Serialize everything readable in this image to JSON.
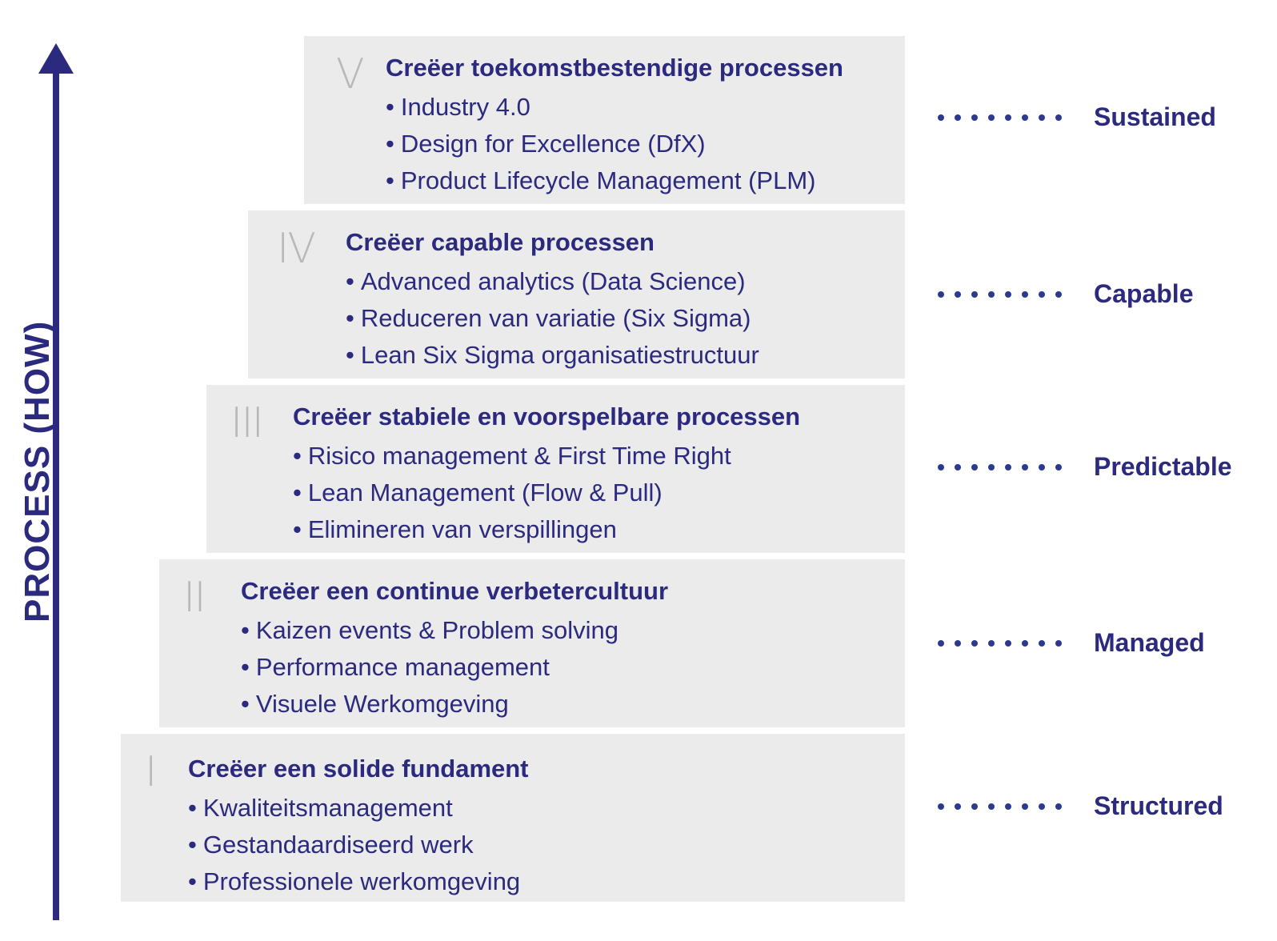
{
  "axis": {
    "label": "PROCESS (HOW)",
    "direction": "up"
  },
  "colors": {
    "primary": "#2b2a7e",
    "step_background": "#ebebeb",
    "numeral": "#b8b8b8",
    "dots": "#2b3a8e"
  },
  "steps": [
    {
      "numeral": "V",
      "title": "Creëer toekomstbestendige processen",
      "items": [
        "Industry 4.0",
        "Design for Excellence (DfX)",
        "Product Lifecycle Management (PLM)"
      ],
      "level": "Sustained"
    },
    {
      "numeral": "IV",
      "title": "Creëer capable processen",
      "items": [
        "Advanced analytics (Data Science)",
        "Reduceren van variatie (Six Sigma)",
        "Lean Six Sigma organisatiestructuur"
      ],
      "level": "Capable"
    },
    {
      "numeral": "III",
      "title": "Creëer stabiele en voorspelbare processen",
      "items": [
        "Risico management & First Time Right",
        "Lean Management (Flow & Pull)",
        "Elimineren van verspillingen"
      ],
      "level": "Predictable"
    },
    {
      "numeral": "II",
      "title": "Creëer een continue verbetercultuur",
      "items": [
        "Kaizen events & Problem solving",
        "Performance management",
        "Visuele Werkomgeving"
      ],
      "level": "Managed"
    },
    {
      "numeral": "I",
      "title": "Creëer een solide fundament",
      "items": [
        "Kwaliteitsmanagement",
        "Gestandaardiseerd werk",
        "Professionele werkomgeving"
      ],
      "level": "Structured"
    }
  ]
}
